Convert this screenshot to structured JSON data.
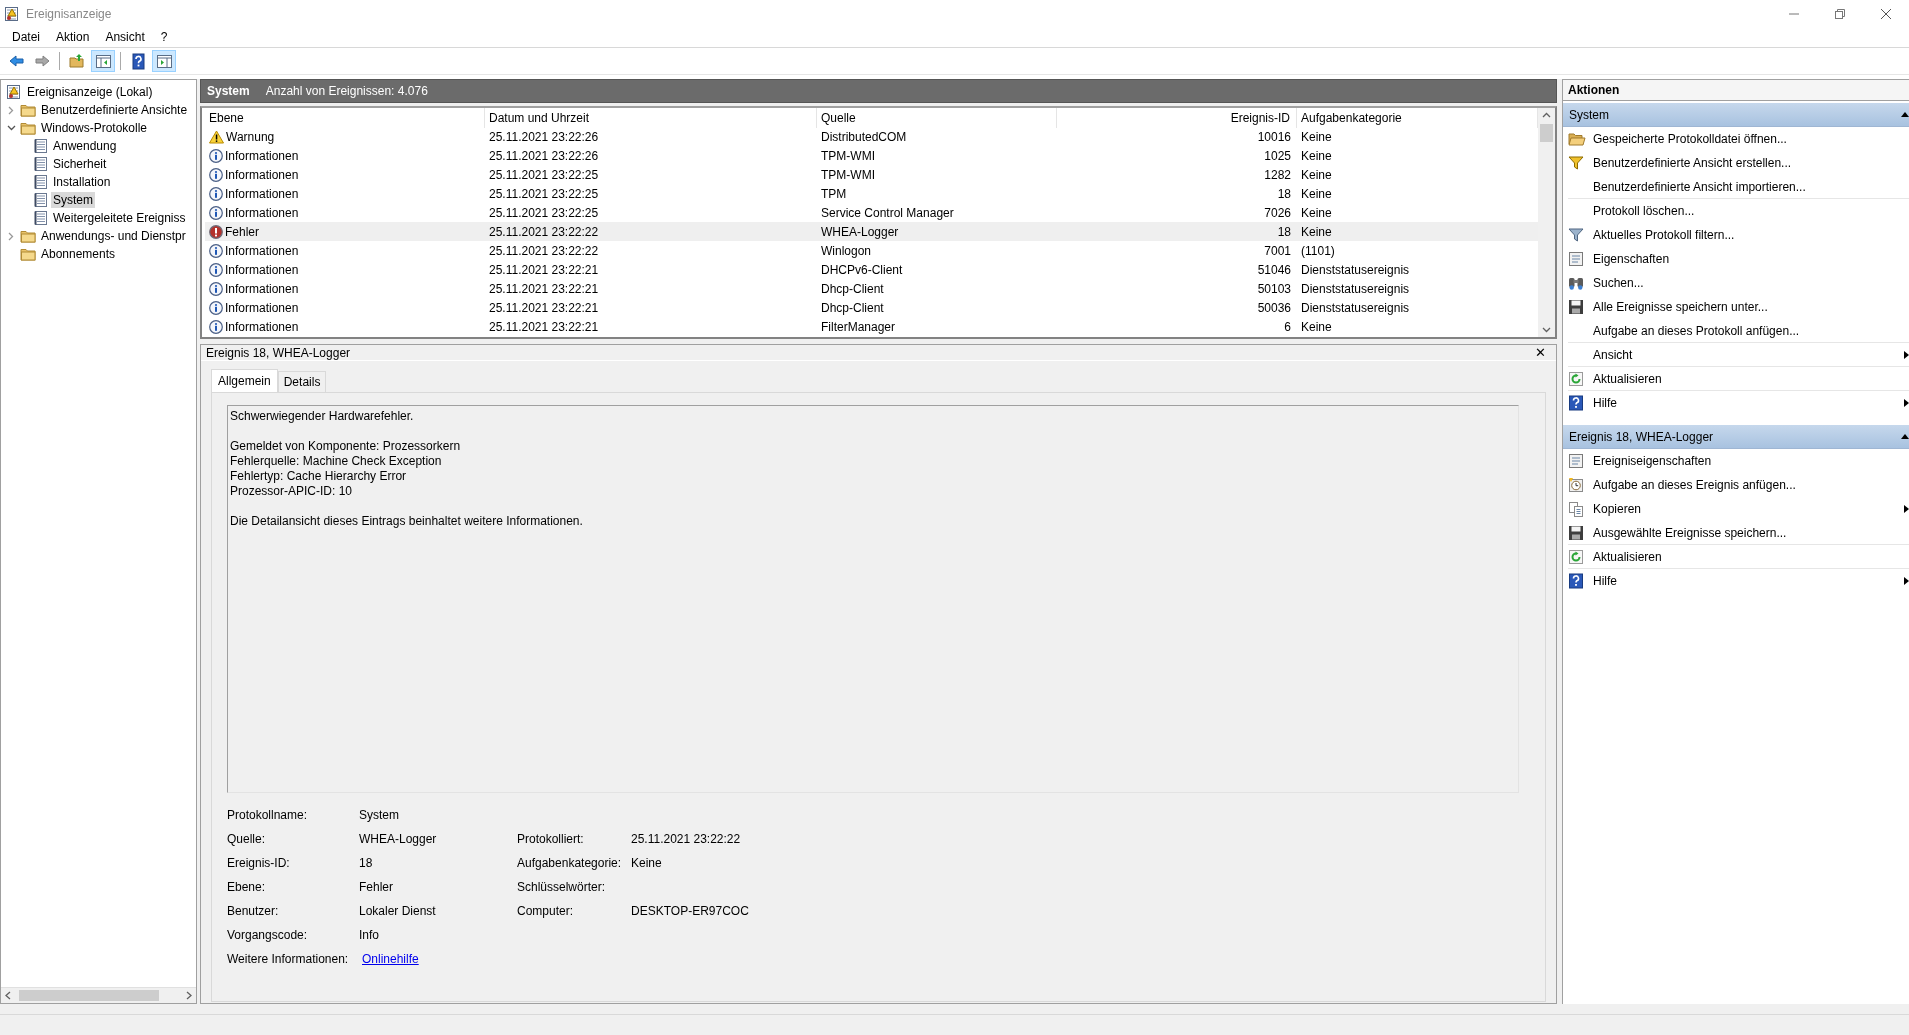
{
  "window": {
    "title": "Ereignisanzeige"
  },
  "menu": [
    "Datei",
    "Aktion",
    "Ansicht",
    "?"
  ],
  "toolbar": [
    {
      "kind": "back",
      "pressed": false,
      "disabled": false
    },
    {
      "kind": "forward",
      "pressed": false,
      "disabled": true
    },
    {
      "kind": "up",
      "pressed": false,
      "disabled": false
    },
    {
      "kind": "tree-pane",
      "pressed": true,
      "disabled": false
    },
    {
      "kind": "help",
      "pressed": false,
      "disabled": false
    },
    {
      "kind": "action-pane",
      "pressed": true,
      "disabled": false
    }
  ],
  "tree": {
    "items": [
      {
        "kind": "root",
        "label": "Ereignisanzeige (Lokal)",
        "selected": false,
        "children": [
          {
            "kind": "folder",
            "label": "Benutzerdefinierte Ansichte",
            "selected": false,
            "expanded": false
          },
          {
            "kind": "folder",
            "label": "Windows-Protokolle",
            "selected": false,
            "expanded": true,
            "children": [
              {
                "kind": "log",
                "label": "Anwendung",
                "selected": false
              },
              {
                "kind": "log",
                "label": "Sicherheit",
                "selected": false
              },
              {
                "kind": "log",
                "label": "Installation",
                "selected": false
              },
              {
                "kind": "log",
                "label": "System",
                "selected": true
              },
              {
                "kind": "log",
                "label": "Weitergeleitete Ereigniss",
                "selected": false
              }
            ]
          },
          {
            "kind": "folder",
            "label": "Anwendungs- und Dienstpr",
            "selected": false,
            "expanded": false
          },
          {
            "kind": "folder",
            "label": "Abonnements",
            "selected": false
          }
        ]
      }
    ]
  },
  "events": {
    "title": "System",
    "count": "Anzahl von Ereignissen: 4.076",
    "columns": [
      "Ebene",
      "Datum und Uhrzeit",
      "Quelle",
      "Ereignis-ID",
      "Aufgabenkategorie"
    ],
    "rows": [
      {
        "kind": "warning",
        "severity": "Warnung",
        "date": "25.11.2021 23:22:26",
        "source": "DistributedCOM",
        "id": "10016",
        "category": "Keine",
        "selected": false
      },
      {
        "kind": "info",
        "severity": "Informationen",
        "date": "25.11.2021 23:22:26",
        "source": "TPM-WMI",
        "id": "1025",
        "category": "Keine",
        "selected": false
      },
      {
        "kind": "info",
        "severity": "Informationen",
        "date": "25.11.2021 23:22:25",
        "source": "TPM-WMI",
        "id": "1282",
        "category": "Keine",
        "selected": false
      },
      {
        "kind": "info",
        "severity": "Informationen",
        "date": "25.11.2021 23:22:25",
        "source": "TPM",
        "id": "18",
        "category": "Keine",
        "selected": false
      },
      {
        "kind": "info",
        "severity": "Informationen",
        "date": "25.11.2021 23:22:25",
        "source": "Service Control Manager",
        "id": "7026",
        "category": "Keine",
        "selected": false
      },
      {
        "kind": "error",
        "severity": "Fehler",
        "date": "25.11.2021 23:22:22",
        "source": "WHEA-Logger",
        "id": "18",
        "category": "Keine",
        "selected": true
      },
      {
        "kind": "info",
        "severity": "Informationen",
        "date": "25.11.2021 23:22:22",
        "source": "Winlogon",
        "id": "7001",
        "category": "(1101)",
        "selected": false
      },
      {
        "kind": "info",
        "severity": "Informationen",
        "date": "25.11.2021 23:22:21",
        "source": "DHCPv6-Client",
        "id": "51046",
        "category": "Dienststatusereignis",
        "selected": false
      },
      {
        "kind": "info",
        "severity": "Informationen",
        "date": "25.11.2021 23:22:21",
        "source": "Dhcp-Client",
        "id": "50103",
        "category": "Dienststatusereignis",
        "selected": false
      },
      {
        "kind": "info",
        "severity": "Informationen",
        "date": "25.11.2021 23:22:21",
        "source": "Dhcp-Client",
        "id": "50036",
        "category": "Dienststatusereignis",
        "selected": false
      },
      {
        "kind": "info",
        "severity": "Informationen",
        "date": "25.11.2021 23:22:21",
        "source": "FilterManager",
        "id": "6",
        "category": "Keine",
        "selected": false
      }
    ]
  },
  "detail": {
    "title": "Ereignis 18, WHEA-Logger",
    "close": "✕",
    "tabs": [
      {
        "label": "Allgemein",
        "selected": true
      },
      {
        "label": "Details",
        "selected": false
      }
    ],
    "message": [
      [
        "Schwerwiegender Hardwarefehler."
      ],
      [
        "Gemeldet von Komponente: Prozessorkern",
        "Fehlerquelle: Machine Check Exception",
        "Fehlertyp: Cache Hierarchy Error",
        "Prozessor-APIC-ID: 10"
      ],
      [
        "Die Detailansicht dieses Eintrags beinhaltet weitere Informationen."
      ]
    ],
    "properties": [
      [
        {
          "label": "Protokollname:",
          "value": "System"
        }
      ],
      [
        {
          "label": "Quelle:",
          "value": "WHEA-Logger"
        },
        {
          "label": "Protokolliert:",
          "value": "25.11.2021 23:22:22"
        }
      ],
      [
        {
          "label": "Ereignis-ID:",
          "value": "18"
        },
        {
          "label": "Aufgabenkategorie:",
          "value": "Keine"
        }
      ],
      [
        {
          "label": "Ebene:",
          "value": "Fehler"
        },
        {
          "label": "Schlüsselwörter:"
        }
      ],
      [
        {
          "label": "Benutzer:",
          "value": "Lokaler Dienst"
        },
        {
          "label": "Computer:",
          "value": "DESKTOP-ER97COC"
        }
      ],
      [
        {
          "label": "Vorgangscode:",
          "value": "Info"
        }
      ],
      [
        {
          "label": "Weitere Informationen:",
          "link": "Onlinehilfe"
        }
      ]
    ]
  },
  "actions": {
    "title": "Aktionen",
    "sections": [
      {
        "title": "System",
        "expanded": true,
        "items": [
          {
            "kind": "open",
            "label": "Gespeicherte Protokolldatei öffnen...",
            "submenu": false,
            "divider_after": false
          },
          {
            "kind": "filter-create",
            "label": "Benutzerdefinierte Ansicht erstellen...",
            "submenu": false,
            "divider_after": false
          },
          {
            "kind": "none",
            "label": "Benutzerdefinierte Ansicht importieren...",
            "submenu": false,
            "divider_after": true
          },
          {
            "kind": "none",
            "label": "Protokoll löschen...",
            "submenu": false,
            "divider_after": false
          },
          {
            "kind": "filter",
            "label": "Aktuelles Protokoll filtern...",
            "submenu": false,
            "divider_after": false
          },
          {
            "kind": "properties",
            "label": "Eigenschaften",
            "submenu": false,
            "divider_after": false
          },
          {
            "kind": "find",
            "label": "Suchen...",
            "submenu": false,
            "divider_after": false
          },
          {
            "kind": "save",
            "label": "Alle Ereignisse speichern unter...",
            "submenu": false,
            "divider_after": false
          },
          {
            "kind": "none",
            "label": "Aufgabe an dieses Protokoll anfügen...",
            "submenu": false,
            "divider_after": true
          },
          {
            "kind": "none",
            "label": "Ansicht",
            "submenu": true,
            "divider_after": true
          },
          {
            "kind": "refresh",
            "label": "Aktualisieren",
            "submenu": false,
            "divider_after": true
          },
          {
            "kind": "help",
            "label": "Hilfe",
            "submenu": true,
            "divider_after": false
          }
        ]
      },
      {
        "title": "Ereignis 18, WHEA-Logger",
        "expanded": true,
        "items": [
          {
            "kind": "properties",
            "label": "Ereigniseigenschaften",
            "submenu": false,
            "divider_after": false
          },
          {
            "kind": "task",
            "label": "Aufgabe an dieses Ereignis anfügen...",
            "submenu": false,
            "divider_after": false
          },
          {
            "kind": "copy",
            "label": "Kopieren",
            "submenu": true,
            "divider_after": false
          },
          {
            "kind": "save",
            "label": "Ausgewählte Ereignisse speichern...",
            "submenu": false,
            "divider_after": true
          },
          {
            "kind": "refresh",
            "label": "Aktualisieren",
            "submenu": false,
            "divider_after": true
          },
          {
            "kind": "help",
            "label": "Hilfe",
            "submenu": true,
            "divider_after": false
          }
        ]
      }
    ]
  }
}
